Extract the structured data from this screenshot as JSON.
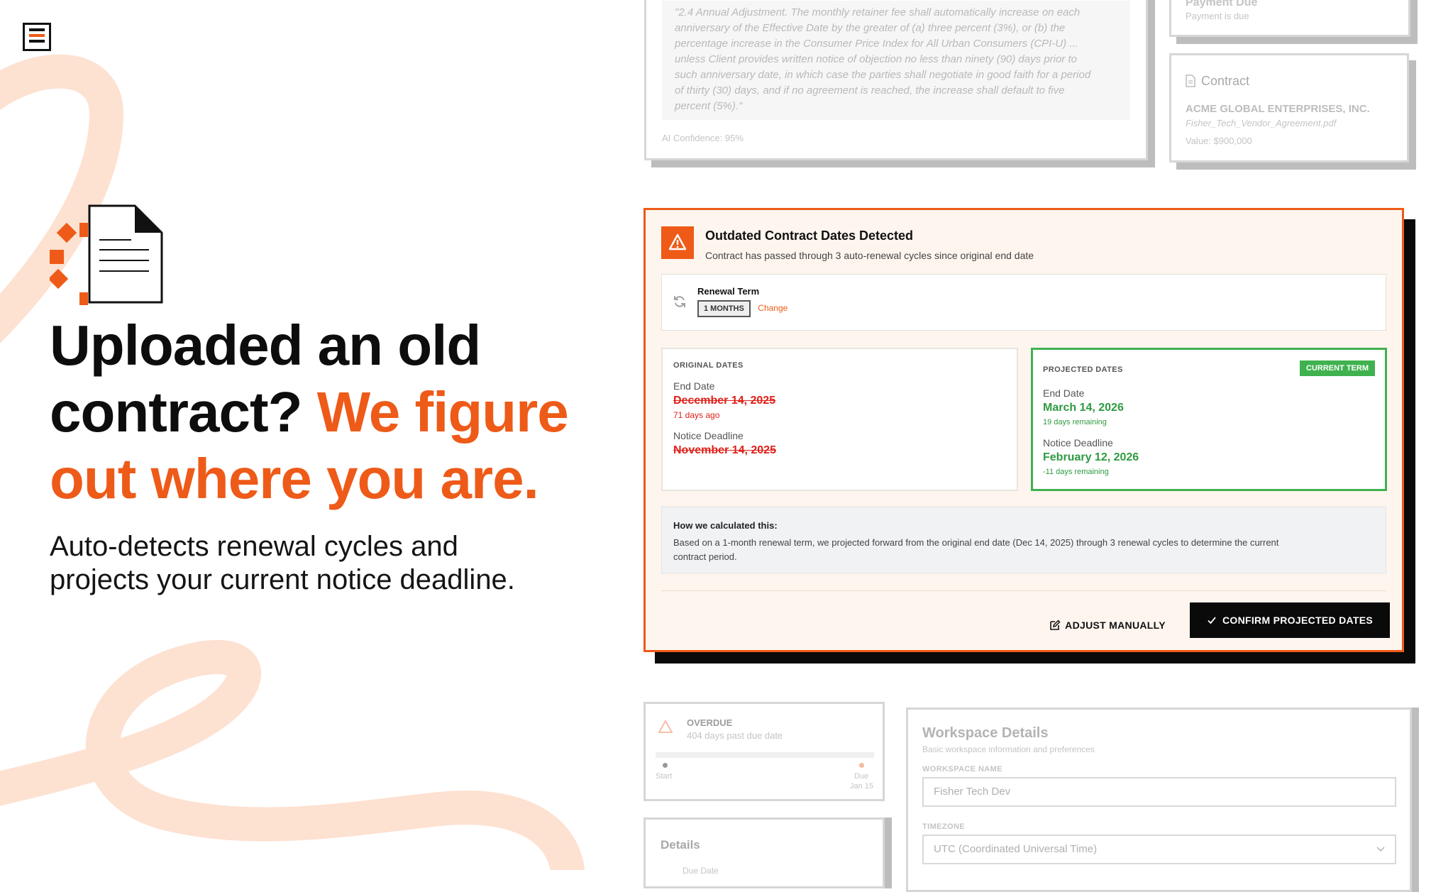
{
  "colors": {
    "accent": "#ee5a18",
    "success": "#3fb24f",
    "danger": "#e0201a",
    "swirl": "#fde1d1",
    "ink": "#0a0a0a"
  },
  "icons": [
    "menu-icon",
    "document-icon",
    "warning-icon",
    "refresh-icon",
    "file-icon",
    "edit-icon",
    "check-icon",
    "chevron-down-icon"
  ],
  "hero": {
    "title_line1": "Uploaded an old",
    "title_line2_start": "contract?",
    "title_line2_accent": "We figure",
    "title_line3_accent": "out where you are.",
    "subtitle_line1": "Auto-detects renewal cycles and",
    "subtitle_line2": "projects your current notice deadline."
  },
  "clause_card": {
    "quote_lines": [
      "\"2.4 Annual Adjustment. The monthly retainer fee shall automatically increase on each",
      "anniversary of the Effective Date by the greater of (a) three percent (3%), or (b) the",
      "percentage increase in the Consumer Price Index for All Urban Consumers (CPI-U) ...",
      "unless Client provides written notice of objection no less than ninety (90) days prior to",
      "such anniversary date, in which case the parties shall negotiate in good faith for a period",
      "of thirty (30) days, and if no agreement is reached, the increase shall default to five",
      "percent (5%).\""
    ],
    "confidence": "AI Confidence: 95%"
  },
  "payment_card": {
    "title": "Payment Due",
    "subtitle": "Payment is due"
  },
  "contract_card": {
    "title": "Contract",
    "company": "ACME GLOBAL ENTERPRISES, INC.",
    "file": "Fisher_Tech_Vendor_Agreement.pdf",
    "value": "Value: $900,000"
  },
  "dialog": {
    "title": "Outdated Contract Dates Detected",
    "subtitle": "Contract has passed through 3 auto-renewal cycles since original end date",
    "renewal": {
      "label": "Renewal Term",
      "value": "1 MONTHS",
      "change": "Change"
    },
    "original": {
      "heading": "ORIGINAL DATES",
      "end_label": "End Date",
      "end_date": "December 14, 2025",
      "end_note": "71 days ago",
      "notice_label": "Notice Deadline",
      "notice_date": "November 14, 2025"
    },
    "projected": {
      "heading": "PROJECTED DATES",
      "badge": "CURRENT TERM",
      "end_label": "End Date",
      "end_date": "March 14, 2026",
      "end_note": "19 days remaining",
      "notice_label": "Notice Deadline",
      "notice_date": "February 12, 2026",
      "notice_note": "-11 days remaining"
    },
    "calc": {
      "title": "How we calculated this:",
      "line1": "Based on a 1-month renewal term, we projected forward from the original end date (Dec 14, 2025) through 3 renewal cycles to determine the current",
      "line2": "contract period."
    },
    "adjust_label": "ADJUST MANUALLY",
    "confirm_label": "CONFIRM PROJECTED DATES"
  },
  "overdue_card": {
    "title": "OVERDUE",
    "subtitle": "404 days past due date",
    "start": "Start",
    "due": "Due",
    "due_date": "Jan 15"
  },
  "details_card": {
    "title": "Details",
    "sub": "Due Date"
  },
  "workspace": {
    "title": "Workspace Details",
    "subtitle": "Basic workspace information and preferences",
    "name_label": "WORKSPACE NAME",
    "name_value": "Fisher Tech Dev",
    "tz_label": "TIMEZONE",
    "tz_value": "UTC (Coordinated Universal Time)"
  }
}
